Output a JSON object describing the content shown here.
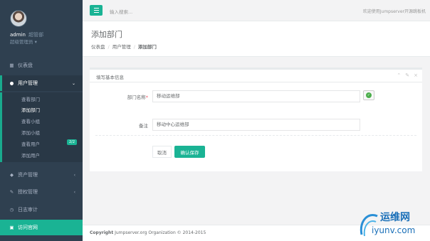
{
  "profile": {
    "name": "admin",
    "role": "超管部",
    "sub": "超级管理员 ▾"
  },
  "nav": {
    "dashboard": "仪表盘",
    "user_mgmt": "用户管理",
    "asset_mgmt": "资产管理",
    "auth_mgmt": "授权管理",
    "logs": "日志审计",
    "website": "访问官网",
    "sub": [
      "查看部门",
      "添加部门",
      "查看小组",
      "添加小组",
      "查看用户",
      "添加用户"
    ],
    "badge": "2/2"
  },
  "topbar": {
    "search_placeholder": "输入搜索...",
    "welcome": "欢迎使用Jumpserver开源跳板机"
  },
  "heading": {
    "title": "添加部门",
    "crumb1": "仪表盘",
    "crumb2": "用户管理",
    "crumb3": "添加部门"
  },
  "panel": {
    "title": "填写基本信息",
    "dept_label": "部门名称",
    "dept_value": "移动运维部",
    "note_label": "备注",
    "note_value": "移动中心运维部",
    "cancel": "取消",
    "save": "确认保存"
  },
  "footer": {
    "bold": "Copyright",
    "text": " Jumpserver.org Organization © 2014-2015"
  },
  "watermark": {
    "cn": "运维网",
    "en": "iyunv.com"
  },
  "colors": {
    "sidebar": "#2f4050",
    "accent": "#1ab394",
    "danger": "#ed5565"
  }
}
